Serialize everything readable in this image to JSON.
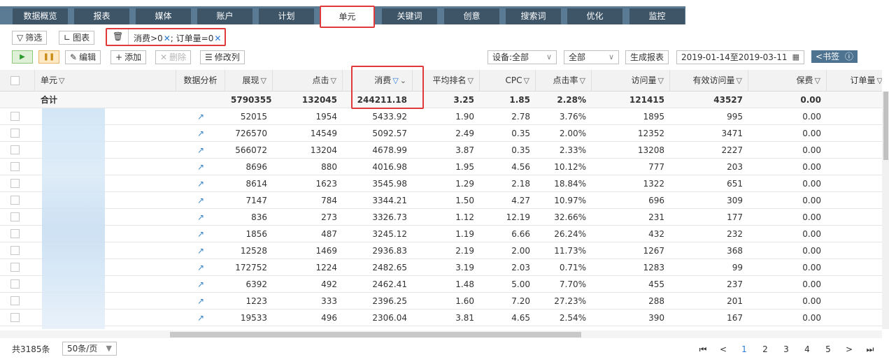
{
  "nav": {
    "tabs": [
      {
        "label": "数据概览"
      },
      {
        "label": "报表"
      },
      {
        "label": "媒体"
      },
      {
        "label": "账户"
      },
      {
        "label": "计划"
      },
      {
        "label": "单元"
      },
      {
        "label": "关键词"
      },
      {
        "label": "创意"
      },
      {
        "label": "搜索词"
      },
      {
        "label": "优化"
      },
      {
        "label": "监控"
      }
    ],
    "active": "单元"
  },
  "toolbar": {
    "filter_label": "筛选",
    "chart_label": "图表",
    "filter_condition_1": "消费>0",
    "filter_condition_sep": ";",
    "filter_condition_2": "订单量=0",
    "edit_label": "编辑",
    "add_label": "添加",
    "delete_label": "删除",
    "columns_label": "修改列",
    "device_select": "设备:全部",
    "scope_select": "全部",
    "report_label": "生成报表",
    "date_range": "2019-01-14至2019-03-11",
    "bookmark_label": "书签"
  },
  "table": {
    "headers": [
      "单元",
      "数据分析",
      "展现",
      "点击",
      "消费",
      "平均排名",
      "CPC",
      "点击率",
      "访问量",
      "有效访问量",
      "保费",
      "订单量"
    ],
    "total_label": "合计",
    "total": [
      "5790355",
      "132045",
      "244211.18",
      "3.25",
      "1.85",
      "2.28%",
      "121415",
      "43527",
      "0.00"
    ],
    "rows": [
      [
        "52015",
        "1954",
        "5433.92",
        "1.90",
        "2.78",
        "3.76%",
        "1895",
        "995",
        "0.00"
      ],
      [
        "726570",
        "14549",
        "5092.57",
        "2.49",
        "0.35",
        "2.00%",
        "12352",
        "3471",
        "0.00"
      ],
      [
        "566072",
        "13204",
        "4678.99",
        "3.87",
        "0.35",
        "2.33%",
        "13208",
        "2227",
        "0.00"
      ],
      [
        "8696",
        "880",
        "4016.98",
        "1.95",
        "4.56",
        "10.12%",
        "777",
        "203",
        "0.00"
      ],
      [
        "8614",
        "1623",
        "3545.98",
        "1.29",
        "2.18",
        "18.84%",
        "1322",
        "651",
        "0.00"
      ],
      [
        "7147",
        "784",
        "3344.21",
        "1.50",
        "4.27",
        "10.97%",
        "696",
        "309",
        "0.00"
      ],
      [
        "836",
        "273",
        "3326.73",
        "1.12",
        "12.19",
        "32.66%",
        "231",
        "177",
        "0.00"
      ],
      [
        "1856",
        "487",
        "3245.12",
        "1.19",
        "6.66",
        "26.24%",
        "432",
        "232",
        "0.00"
      ],
      [
        "12528",
        "1469",
        "2936.83",
        "2.19",
        "2.00",
        "11.73%",
        "1267",
        "368",
        "0.00"
      ],
      [
        "172752",
        "1224",
        "2482.65",
        "3.19",
        "2.03",
        "0.71%",
        "1283",
        "99",
        "0.00"
      ],
      [
        "6392",
        "492",
        "2462.41",
        "1.48",
        "5.00",
        "7.70%",
        "455",
        "237",
        "0.00"
      ],
      [
        "1223",
        "333",
        "2396.25",
        "1.60",
        "7.20",
        "27.23%",
        "288",
        "201",
        "0.00"
      ],
      [
        "19533",
        "496",
        "2306.04",
        "3.81",
        "4.65",
        "2.54%",
        "390",
        "167",
        "0.00"
      ]
    ]
  },
  "footer": {
    "total_count": "共3185条",
    "page_size": "50条/页",
    "pages": [
      "1",
      "2",
      "3",
      "4",
      "5"
    ],
    "current_page": "1"
  },
  "colors": {
    "nav_bg": "#5b7a93",
    "tab_bg": "#3e5568",
    "highlight": "#e0393a",
    "link": "#2a7ad6"
  }
}
